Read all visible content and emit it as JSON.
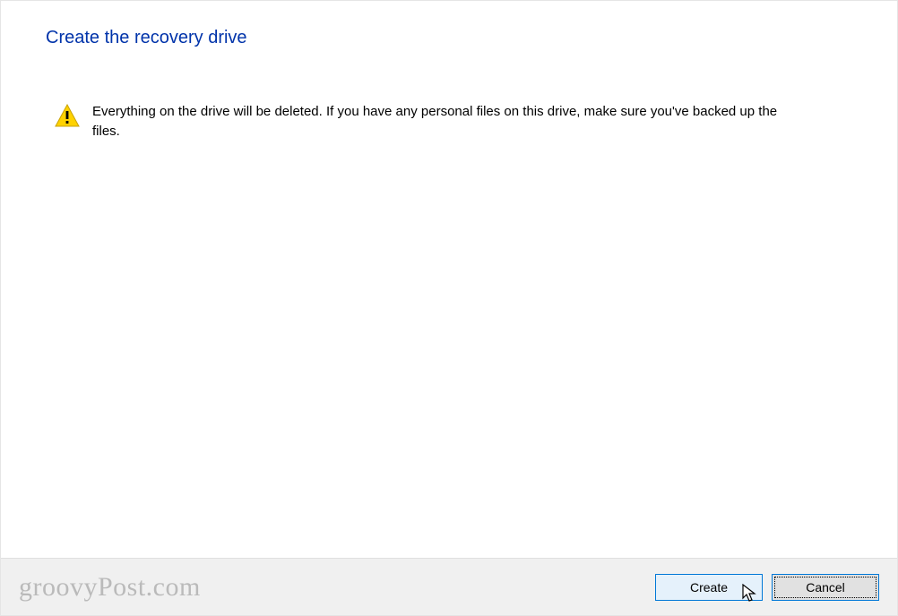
{
  "dialog": {
    "title": "Create the recovery drive",
    "warning_message": "Everything on the drive will be deleted. If you have any personal files on this drive, make sure you've backed up the files."
  },
  "footer": {
    "watermark": "groovyPost.com",
    "buttons": {
      "create": "Create",
      "cancel": "Cancel"
    }
  }
}
